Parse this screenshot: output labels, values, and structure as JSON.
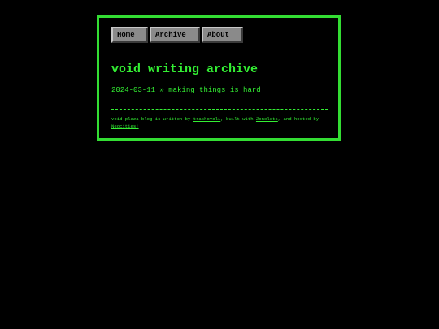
{
  "nav": {
    "home_label": "Home",
    "archive_label": "Archive",
    "about_label": "About"
  },
  "page_title": "void writing archive",
  "entries": [
    {
      "date": "2024-03-11",
      "separator": "»",
      "title": "making things is hard"
    }
  ],
  "footer": {
    "text_1": "void plaza blog is written by ",
    "author_link": "trashovoli",
    "text_2": ", built with ",
    "builder_link": "Zonelets",
    "text_3": ", and hosted by ",
    "host_link": "Neocities!"
  },
  "colors": {
    "background": "#000000",
    "accent": "#33ee33",
    "frame_border": "#33dd33",
    "button_face": "#8a8a8a"
  }
}
